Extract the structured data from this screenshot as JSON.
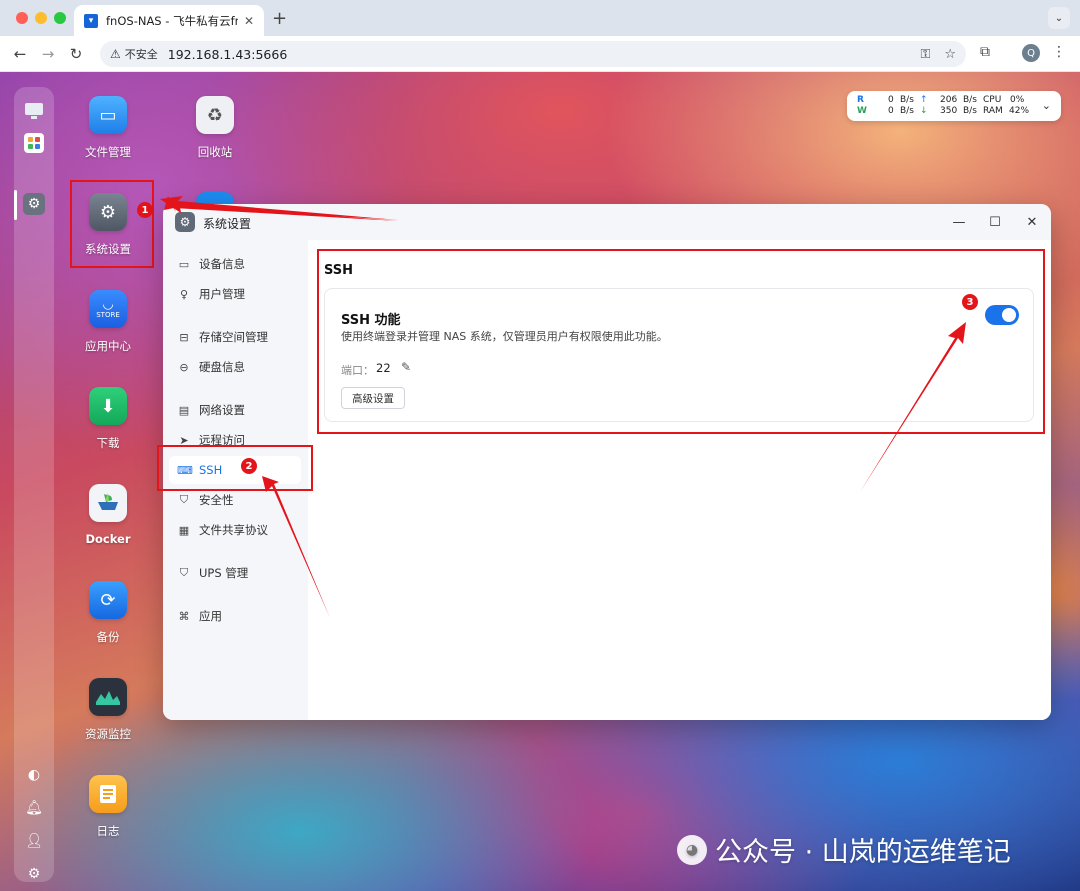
{
  "browser": {
    "tab_title": "fnOS-NAS - 飞牛私有云fnOS",
    "tab_close": "✕",
    "new_tab": "+",
    "insecure_label": "不安全",
    "url": "192.168.1.43:5666",
    "profile_initial": "Q"
  },
  "desktop": {
    "apps": [
      {
        "label": "文件管理",
        "icon": "folder-icon"
      },
      {
        "label": "回收站",
        "icon": "recycle-bin-icon"
      },
      {
        "label": "系统设置",
        "icon": "gear-icon"
      },
      {
        "label": "应用中心",
        "icon": "store-icon",
        "badge": "STORE"
      },
      {
        "label": "下载",
        "icon": "download-icon"
      },
      {
        "label": "Docker",
        "icon": "docker-icon"
      },
      {
        "label": "备份",
        "icon": "backup-icon"
      },
      {
        "label": "资源监控",
        "icon": "resource-monitor-icon"
      },
      {
        "label": "日志",
        "icon": "log-icon"
      }
    ]
  },
  "monitor": {
    "r_label": "R",
    "w_label": "W",
    "r_down": "0",
    "w_down": "0",
    "unit": "B/s",
    "r_up": "206",
    "w_up": "350",
    "cpu_label": "CPU",
    "cpu_value": "0%",
    "ram_label": "RAM",
    "ram_value": "42%"
  },
  "window": {
    "title": "系统设置",
    "sidebar": [
      {
        "label": "设备信息",
        "icon": "device-info-icon"
      },
      {
        "label": "用户管理",
        "icon": "user-management-icon"
      },
      {
        "label": "存储空间管理",
        "icon": "storage-icon"
      },
      {
        "label": "硬盘信息",
        "icon": "disk-icon"
      },
      {
        "label": "网络设置",
        "icon": "network-icon"
      },
      {
        "label": "远程访问",
        "icon": "remote-access-icon"
      },
      {
        "label": "SSH",
        "icon": "ssh-icon",
        "active": true
      },
      {
        "label": "安全性",
        "icon": "security-icon"
      },
      {
        "label": "文件共享协议",
        "icon": "file-share-icon"
      },
      {
        "label": "UPS 管理",
        "icon": "ups-icon"
      },
      {
        "label": "应用",
        "icon": "apps-icon"
      }
    ],
    "section_title": "SSH",
    "card": {
      "title": "SSH 功能",
      "description": "使用终端登录并管理 NAS 系统，仅管理员用户有权限使用此功能。",
      "port_label": "端口：",
      "port_value": "22",
      "advanced_button": "高级设置",
      "enabled": true
    }
  },
  "annotations": {
    "callout_1": "1",
    "callout_2": "2",
    "callout_3": "3"
  },
  "watermark": "公众号 · 山岚的运维笔记",
  "colors": {
    "accent": "#1a73e8",
    "annotation_red": "#e4141b"
  }
}
